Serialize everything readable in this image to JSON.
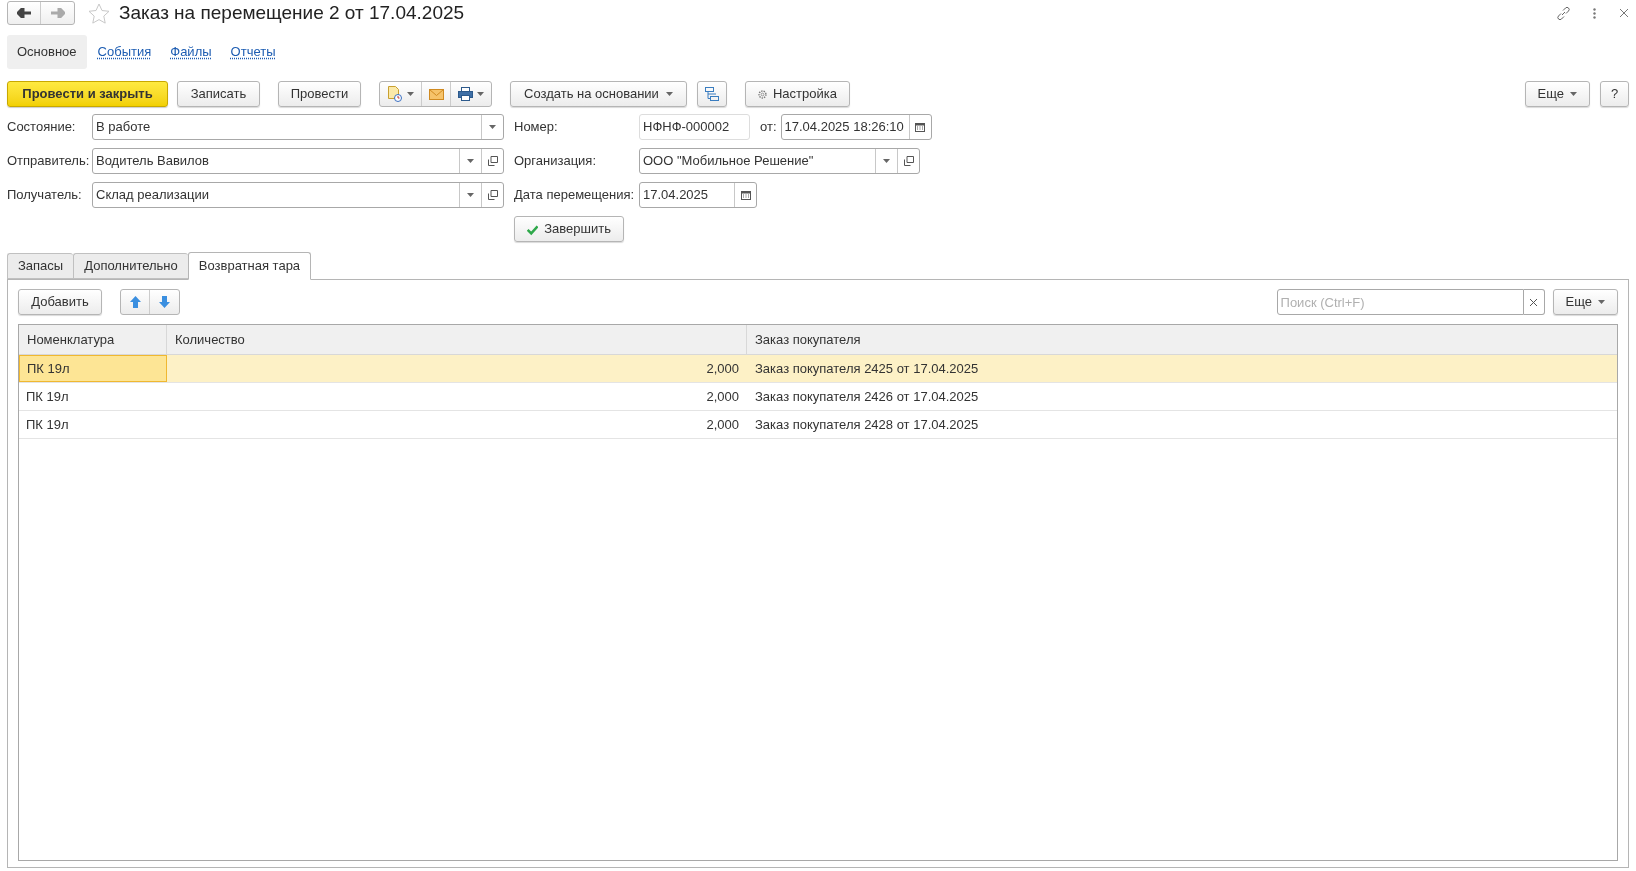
{
  "window": {
    "title": "Заказ на перемещение 2 от 17.04.2025"
  },
  "nav": [
    {
      "label": "Основное",
      "selected": true
    },
    {
      "label": "События",
      "selected": false
    },
    {
      "label": "Файлы",
      "selected": false
    },
    {
      "label": "Отчеты",
      "selected": false
    }
  ],
  "toolbar": {
    "post_close": "Провести и закрыть",
    "save": "Записать",
    "post": "Провести",
    "create_based": "Создать на основании",
    "settings": "Настройка",
    "more": "Еще",
    "help": "?"
  },
  "left_fields": [
    {
      "label": "Состояние:",
      "value": "В работе",
      "kind": "select"
    },
    {
      "label": "Отправитель:",
      "value": "Водитель Вавилов",
      "kind": "ref"
    },
    {
      "label": "Получатель:",
      "value": "Склад реализации",
      "kind": "ref"
    }
  ],
  "number": {
    "label": "Номер:",
    "value": "НФНФ-000002",
    "date_label": "от:",
    "date_value": "17.04.2025 18:26:10"
  },
  "organization": {
    "label": "Организация:",
    "value": "ООО \"Мобильное Решение\""
  },
  "move_date": {
    "label": "Дата перемещения:",
    "value": "17.04.2025"
  },
  "complete_button": "Завершить",
  "tabs": [
    {
      "label": "Запасы",
      "selected": false
    },
    {
      "label": "Дополнительно",
      "selected": false
    },
    {
      "label": "Возвратная тара",
      "selected": true
    }
  ],
  "table_toolbar": {
    "add": "Добавить",
    "search_placeholder": "Поиск (Ctrl+F)",
    "more": "Еще"
  },
  "table": {
    "columns": [
      "Номенклатура",
      "Количество",
      "Заказ покупателя"
    ],
    "rows": [
      {
        "item": "ПК 19л",
        "quantity": "2,000",
        "order": "Заказ покупателя 2425 от 17.04.2025",
        "selected": true
      },
      {
        "item": "ПК 19л",
        "quantity": "2,000",
        "order": "Заказ покупателя 2426 от 17.04.2025",
        "selected": false
      },
      {
        "item": "ПК 19л",
        "quantity": "2,000",
        "order": "Заказ покупателя 2428 от 17.04.2025",
        "selected": false
      }
    ]
  }
}
